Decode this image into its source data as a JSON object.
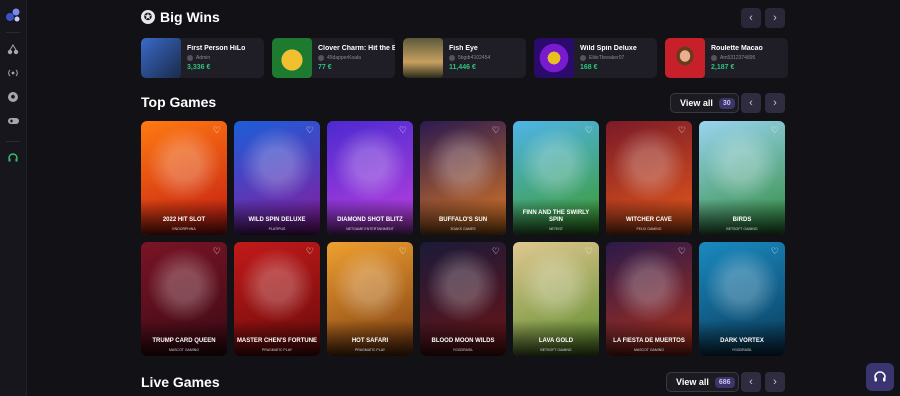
{
  "sidebar": {
    "icons": [
      "logo-icon",
      "cherries-icon",
      "broadcast-icon",
      "soccer-ball-icon",
      "gamepad-icon",
      "support-icon"
    ]
  },
  "big_wins": {
    "title": "Big Wins",
    "items": [
      {
        "game": "First Person HiLo",
        "user": "Admin",
        "amount": "3,336 €",
        "thumb_color": "#2c4e8a"
      },
      {
        "game": "Clover Charm: Hit the Bo",
        "user": "45dapperKoala",
        "amount": "77 €",
        "thumb_color": "#1e7a2e"
      },
      {
        "game": "Fish Eye",
        "user": "5bgdr4102454",
        "amount": "11,446 €",
        "thumb_color": "#3a3a2a"
      },
      {
        "game": "Wild Spin Deluxe",
        "user": "EliteTbreaker07",
        "amount": "168 €",
        "thumb_color": "#3b1a8a"
      },
      {
        "game": "Roulette Macao",
        "user": "Am5312374895",
        "amount": "2,187 €",
        "thumb_color": "#b8202a"
      }
    ]
  },
  "top_games": {
    "title": "Top Games",
    "view_all": "View all",
    "count": "30",
    "row1": [
      {
        "name": "2022 HIT SLOT",
        "provider": "ENDORPHINA",
        "colors": [
          "#ff7a12",
          "#c21a12"
        ]
      },
      {
        "name": "WILD SPIN DELUXE",
        "provider": "PLATIPUS",
        "colors": [
          "#1c5ed8",
          "#8a1a9e"
        ]
      },
      {
        "name": "DIAMOND SHOT BLITZ",
        "provider": "NETGAME ENTERTAINMENT",
        "colors": [
          "#4b2ad0",
          "#c040e0"
        ]
      },
      {
        "name": "BUFFALO'S SUN",
        "provider": "3OAKS GAMES",
        "colors": [
          "#2a1a50",
          "#e07a22"
        ]
      },
      {
        "name": "FINN AND THE SWIRLY SPIN",
        "provider": "NETENT",
        "colors": [
          "#4fb4e8",
          "#3c9a28"
        ]
      },
      {
        "name": "WITCHER CAVE",
        "provider": "FELIX GAMING",
        "colors": [
          "#7a1a28",
          "#e85a1a"
        ]
      },
      {
        "name": "BIRDS",
        "provider": "BETSOFT GAMING",
        "colors": [
          "#9ad4f0",
          "#2e8a3a"
        ]
      }
    ],
    "row2": [
      {
        "name": "TRUMP CARD QUEEN",
        "provider": "MASCOT GAMING",
        "colors": [
          "#7a1426",
          "#3a0a14"
        ]
      },
      {
        "name": "MASTER CHEN'S FORTUNE",
        "provider": "PRAGMATIC PLAY",
        "colors": [
          "#c21a1a",
          "#6a0a0a"
        ]
      },
      {
        "name": "HOT SAFARI",
        "provider": "PRAGMATIC PLAY",
        "colors": [
          "#f0a030",
          "#7a3a10"
        ]
      },
      {
        "name": "BLOOD MOON WILDS",
        "provider": "YGGDRASIL",
        "colors": [
          "#1a1a3a",
          "#6a1414"
        ]
      },
      {
        "name": "LAVA GOLD",
        "provider": "BETSOFT GAMING",
        "colors": [
          "#e0c890",
          "#5a8a2a"
        ]
      },
      {
        "name": "LA FIESTA DE MUERTOS",
        "provider": "MASCOT GAMING",
        "colors": [
          "#2a1a4a",
          "#b0301a"
        ]
      },
      {
        "name": "DARK VORTEX",
        "provider": "YGGDRASIL",
        "colors": [
          "#1a8ac0",
          "#0a3a5a"
        ]
      }
    ]
  },
  "live_games": {
    "title": "Live Games",
    "view_all": "View all",
    "count": "686"
  },
  "nav": {
    "prev": "‹",
    "next": "›"
  },
  "glyphs": {
    "heart": "♡",
    "star": "✪",
    "headset": "🎧"
  }
}
